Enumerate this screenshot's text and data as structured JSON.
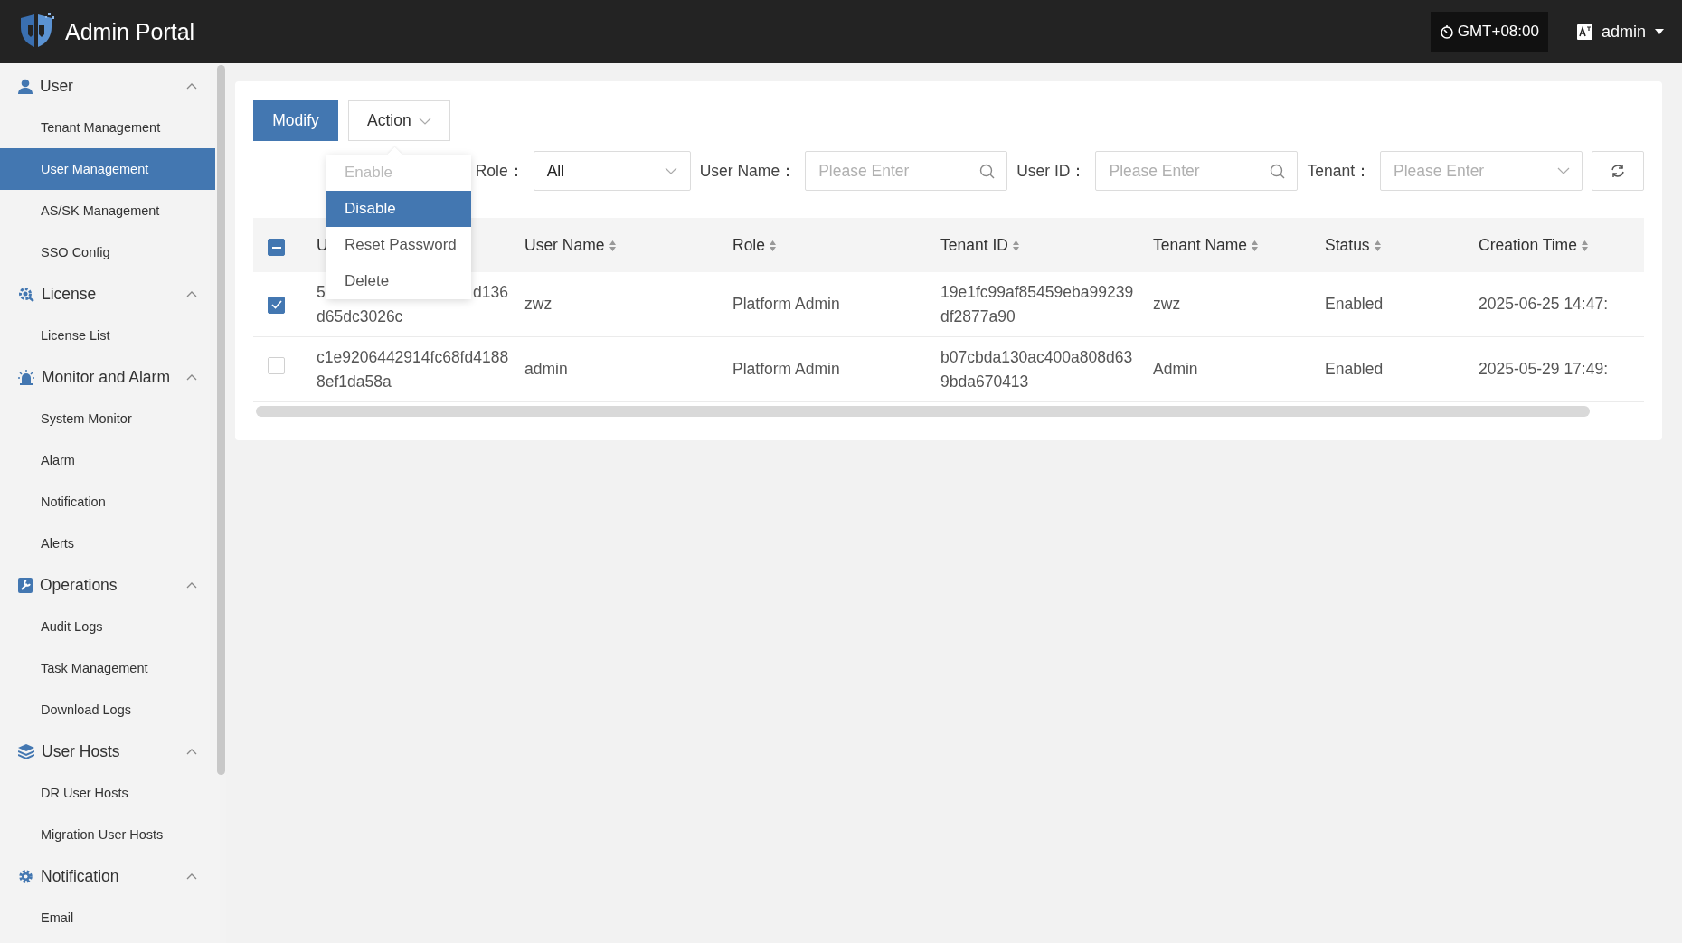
{
  "header": {
    "title": "Admin Portal",
    "timezone": "GMT+08:00",
    "user": "admin"
  },
  "sidebar": {
    "groups": [
      {
        "label": "User",
        "expanded": true,
        "items": [
          {
            "label": "Tenant Management",
            "selected": false
          },
          {
            "label": "User Management",
            "selected": true
          },
          {
            "label": "AS/SK Management",
            "selected": false
          },
          {
            "label": "SSO Config",
            "selected": false
          }
        ]
      },
      {
        "label": "License",
        "expanded": true,
        "items": [
          {
            "label": "License List",
            "selected": false
          }
        ]
      },
      {
        "label": "Monitor and Alarm",
        "expanded": true,
        "items": [
          {
            "label": "System Monitor",
            "selected": false
          },
          {
            "label": "Alarm",
            "selected": false
          },
          {
            "label": "Notification",
            "selected": false
          },
          {
            "label": "Alerts",
            "selected": false
          }
        ]
      },
      {
        "label": "Operations",
        "expanded": true,
        "items": [
          {
            "label": "Audit Logs",
            "selected": false
          },
          {
            "label": "Task Management",
            "selected": false
          },
          {
            "label": "Download Logs",
            "selected": false
          }
        ]
      },
      {
        "label": "User Hosts",
        "expanded": true,
        "items": [
          {
            "label": "DR User Hosts",
            "selected": false
          },
          {
            "label": "Migration User Hosts",
            "selected": false
          }
        ]
      },
      {
        "label": "Notification",
        "expanded": true,
        "items": [
          {
            "label": "Email",
            "selected": false
          }
        ]
      }
    ]
  },
  "toolbar": {
    "primary": "Modify",
    "action": "Action"
  },
  "action_menu": [
    {
      "label": "Enable",
      "disabled": true,
      "selected": false
    },
    {
      "label": "Disable",
      "disabled": false,
      "selected": true
    },
    {
      "label": "Reset Password",
      "disabled": false,
      "selected": false
    },
    {
      "label": "Delete",
      "disabled": false,
      "selected": false
    }
  ],
  "filters": [
    {
      "label": "Role：",
      "kind": "select",
      "value": "All"
    },
    {
      "label": "User Name：",
      "kind": "search",
      "placeholder": "Please Enter"
    },
    {
      "label": "User ID：",
      "kind": "search",
      "placeholder": "Please Enter"
    },
    {
      "label": "Tenant：",
      "kind": "select",
      "placeholder": "Please Enter"
    }
  ],
  "table": {
    "header_checkbox": {
      "indeterminate": true
    },
    "columns": [
      {
        "label": "U"
      },
      {
        "label": "User Name",
        "sortable": true
      },
      {
        "label": "Role",
        "sortable": true
      },
      {
        "label": "Tenant ID",
        "sortable": true
      },
      {
        "label": "Tenant Name",
        "sortable": true
      },
      {
        "label": "Status",
        "sortable": true
      },
      {
        "label": "Creation Time",
        "sortable": true
      }
    ],
    "rows": [
      {
        "selected": true,
        "user_id_fragments": [
          "5",
          "d136",
          "d65dc3026c"
        ],
        "user_name": "zwz",
        "role": "Platform Admin",
        "tenant_id": "19e1fc99af85459eba99239df2877a90",
        "tenant_name": "zwz",
        "status": "Enabled",
        "creation_time": "2025-06-25 14:47:"
      },
      {
        "selected": false,
        "user_id": "c1e9206442914fc68fd41888ef1da58a",
        "user_name": "admin",
        "role": "Platform Admin",
        "tenant_id": "b07cbda130ac400a808d639bda670413",
        "tenant_name": "Admin",
        "status": "Enabled",
        "creation_time": "2025-05-29 17:49:"
      }
    ]
  }
}
